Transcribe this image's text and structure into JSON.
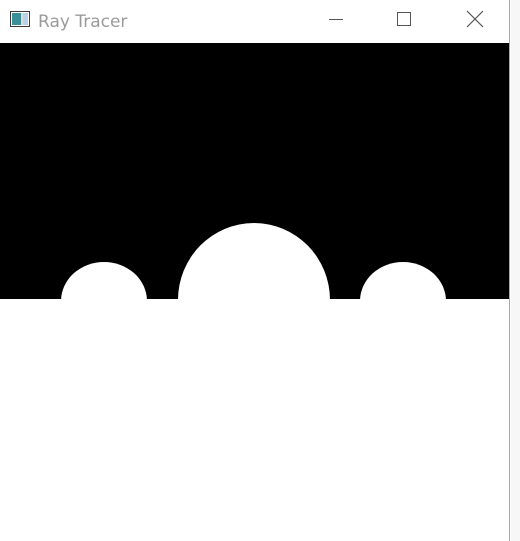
{
  "window": {
    "title": "Ray Tracer",
    "icon": "app-window-icon"
  },
  "controls": {
    "minimize_icon": "minimize-icon",
    "maximize_icon": "maximize-icon",
    "close_icon": "close-icon"
  },
  "render": {
    "sky_color": "#000000",
    "ground_color": "#ffffff",
    "sphere_color": "#ffffff"
  }
}
